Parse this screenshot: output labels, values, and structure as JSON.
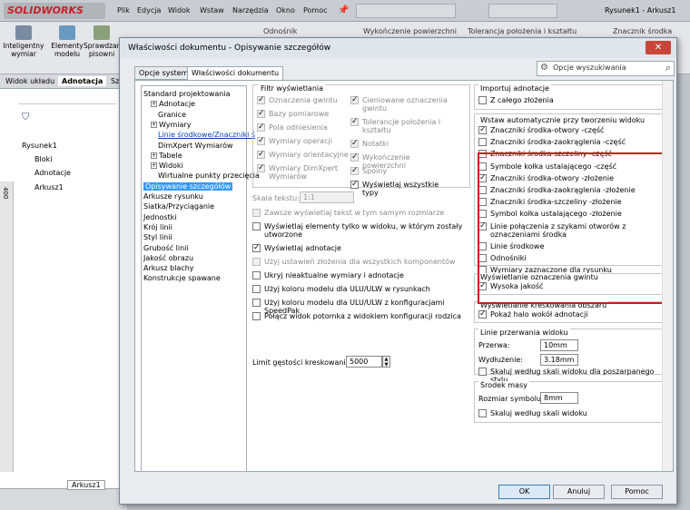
{
  "app": {
    "logo": "SOLIDWORKS",
    "title": "Rysunek1 - Arkusz1"
  },
  "menu": [
    "Plik",
    "Edycja",
    "Widok",
    "Wstaw",
    "Narzędzia",
    "Okno",
    "Pomoc"
  ],
  "cmdbar": {
    "items": [
      "Inteligentny wymiar",
      "Elementy modelu",
      "Sprawdzanie pisowni"
    ],
    "right_items": [
      "Odnośnik",
      "Wykończenie powierzchni",
      "Tolerancja położenia i kształtu",
      "Znacznik środka"
    ]
  },
  "cm_tabs": [
    "Widok układu",
    "Adnotacja",
    "Szk"
  ],
  "tree_left": {
    "root": "Rysunek1",
    "items": [
      "Bloki",
      "Adnotacje",
      "Arkusz1"
    ],
    "ruler": "400"
  },
  "bottom_tab": "Arkusz1",
  "dialog": {
    "title": "Właściwości dokumentu - Opisywanie szczegółów",
    "close": "✕",
    "tabs": [
      "Opcje systemu",
      "Właściwości dokumentu"
    ],
    "search_placeholder": "Opcje wyszukiwania",
    "tree": [
      {
        "label": "Standard projektowania",
        "level": 0
      },
      {
        "label": "Adnotacje",
        "level": 1,
        "exp": true
      },
      {
        "label": "Granice",
        "level": 2
      },
      {
        "label": "Wymiary",
        "level": 1,
        "exp": true
      },
      {
        "label": "Linie środkowe/Znaczniki ś",
        "level": 2,
        "link": true
      },
      {
        "label": "DimXpert Wymiarów",
        "level": 2
      },
      {
        "label": "Tabele",
        "level": 1,
        "exp": true
      },
      {
        "label": "Widoki",
        "level": 1,
        "exp": true
      },
      {
        "label": "Wirtualne punkty przecięcia",
        "level": 2
      },
      {
        "label": "Opisywanie szczegółów",
        "level": 0,
        "selected": true
      },
      {
        "label": "Arkusze rysunku",
        "level": 0
      },
      {
        "label": "Siatka/Przyciąganie",
        "level": 0
      },
      {
        "label": "Jednostki",
        "level": 0
      },
      {
        "label": "Krój linii",
        "level": 0
      },
      {
        "label": "Styl linii",
        "level": 0
      },
      {
        "label": "Grubość linii",
        "level": 0
      },
      {
        "label": "Jakość obrazu",
        "level": 0
      },
      {
        "label": "Arkusz blachy",
        "level": 0
      },
      {
        "label": "Konstrukcje spawane",
        "level": 0
      }
    ],
    "filter": {
      "title": "Filtr wyświetlania",
      "col1": [
        {
          "label": "Oznaczenia gwintu",
          "checked": true,
          "disabled": true
        },
        {
          "label": "Bazy pomiarowe",
          "checked": true,
          "disabled": true
        },
        {
          "label": "Pola odniesienia",
          "checked": true,
          "disabled": true
        },
        {
          "label": "Wymiary operacji",
          "checked": true,
          "disabled": true
        },
        {
          "label": "Wymiary orientacyjne",
          "checked": true,
          "disabled": true
        },
        {
          "label": "Wymiary DimXpert Wymiarów",
          "checked": true,
          "disabled": true
        }
      ],
      "col2": [
        {
          "label": "Cieniowane oznaczenia gwintu",
          "checked": true,
          "disabled": true
        },
        {
          "label": "Tolerancje położenia i kształtu",
          "checked": true,
          "disabled": true
        },
        {
          "label": "Notatki",
          "checked": true,
          "disabled": true
        },
        {
          "label": "Wykończenie powierzchni",
          "checked": true,
          "disabled": true
        },
        {
          "label": "Spoiny",
          "checked": true,
          "disabled": true
        },
        {
          "label": "Wyświetlaj wszystkie typy",
          "checked": true,
          "disabled": false
        }
      ]
    },
    "text_scale": {
      "label": "Skala tekstu:",
      "value": "1:1"
    },
    "mid_options": [
      {
        "label": "Zawsze wyświetlaj tekst w tym samym rozmiarze",
        "checked": false,
        "disabled": true
      },
      {
        "label": "Wyświetlaj elementy tylko w widoku, w którym zostały utworzone",
        "checked": false,
        "disabled": false
      },
      {
        "label": "Wyświetlaj adnotacje",
        "checked": true,
        "disabled": false
      },
      {
        "label": "Użyj ustawień złożenia dla wszystkich komponentów",
        "checked": false,
        "disabled": true
      },
      {
        "label": "Ukryj nieaktualne wymiary i adnotacje",
        "checked": false,
        "disabled": false
      },
      {
        "label": "Użyj koloru modelu dla ULU/ULW w rysunkach",
        "checked": false,
        "disabled": false
      },
      {
        "label": "Użyj koloru modelu dla ULU/ULW z konfiguracjami SpeedPak",
        "checked": false,
        "disabled": false
      },
      {
        "label": "Połącz widok potomka z widokiem konfiguracji rodzica",
        "checked": false,
        "disabled": false
      }
    ],
    "hatch_limit": {
      "label": "Limit gęstości kreskowania:",
      "value": "5000"
    },
    "import": {
      "title": "Importuj adnotacje",
      "items": [
        {
          "label": "Z całego złożenia",
          "checked": false
        }
      ]
    },
    "auto_insert": {
      "title": "Wstaw automatycznie przy tworzeniu widoku",
      "items": [
        {
          "label": "Znaczniki środka-otwory -część",
          "checked": true
        },
        {
          "label": "Znaczniki środka-zaokrąglenia -część",
          "checked": false
        },
        {
          "label": "Znaczniki środka-szczeliny -część",
          "checked": false
        },
        {
          "label": "Symbole kołka ustalającego -część",
          "checked": false
        },
        {
          "label": "Znaczniki środka-otwory -złożenie",
          "checked": true
        },
        {
          "label": "Znaczniki środka-zaokrąglenia -złożenie",
          "checked": false
        },
        {
          "label": "Znaczniki środka-szczeliny -złożenie",
          "checked": false
        },
        {
          "label": "Symbol kołka ustalającego -złożenie",
          "checked": false
        },
        {
          "label": "Linie połączenia z szykami otworów z oznaczeniami środka",
          "checked": true
        },
        {
          "label": "Linie środkowe",
          "checked": false
        },
        {
          "label": "Odnośniki",
          "checked": false
        },
        {
          "label": "Wymiary zaznaczone dla rysunku",
          "checked": false
        }
      ]
    },
    "thread": {
      "title": "Wyświetlanie oznaczenia gwintu",
      "items": [
        {
          "label": "Wysoka jakość",
          "checked": true
        }
      ]
    },
    "hatch_display": {
      "title": "Wyświetlanie kreskowania obszaru",
      "items": [
        {
          "label": "Pokaż halo wokół adnotacji",
          "checked": true
        }
      ]
    },
    "break_lines": {
      "title": "Linie przerwania widoku",
      "gap_label": "Przerwa:",
      "gap": "10mm",
      "ext_label": "Wydłużenie:",
      "ext": "3.18mm",
      "scale_label": "Skaluj według skali widoku dla poszarpanego stylu"
    },
    "centermark": {
      "title": "Środek masy",
      "size_label": "Rozmiar symbolu:",
      "size": "8mm",
      "scale_label": "Skaluj według skali widoku"
    },
    "buttons": {
      "ok": "OK",
      "cancel": "Anuluj",
      "help": "Pomoc"
    }
  },
  "colors": {
    "highlight": "#d0181a",
    "selection": "#3399ff"
  }
}
